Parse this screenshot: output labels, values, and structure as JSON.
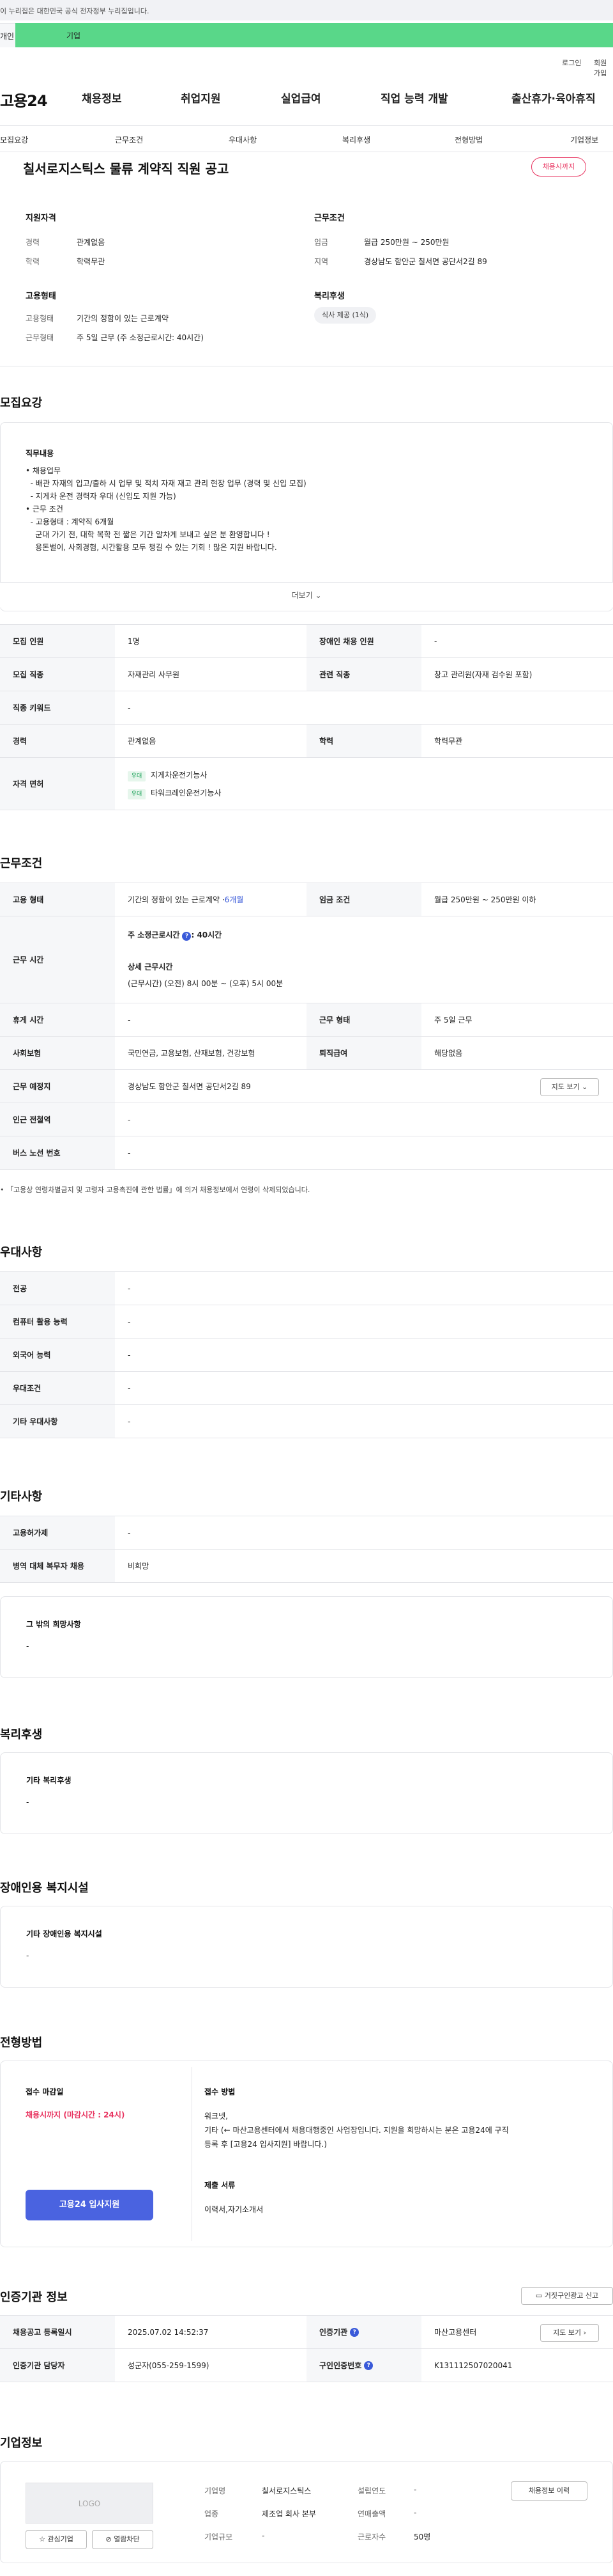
{
  "gov_banner": "이 누리집은 대한민국 공식 전자정부 누리집입니다.",
  "top_tabs": {
    "individual": "개인",
    "business": "기업"
  },
  "util": {
    "login": "로그인",
    "join": "회원가입"
  },
  "logo": "고용24",
  "nav": [
    "채용정보",
    "취업지원",
    "실업급여",
    "직업 능력 개발",
    "출산휴가·육아휴직"
  ],
  "subnav": [
    "모집요강",
    "근무조건",
    "우대사항",
    "복리후생",
    "전형방법",
    "기업정보"
  ],
  "job": {
    "title": "칠서로지스틱스 물류 계약직 직원 공고",
    "status": "채용시까지"
  },
  "summary": {
    "qual_title": "지원자격",
    "career_label": "경력",
    "career": "관계없음",
    "edu_label": "학력",
    "edu": "학력무관",
    "cond_title": "근무조건",
    "wage_label": "임금",
    "wage": "월급 250만원 ~ 250만원",
    "region_label": "지역",
    "region": "경상남도 함안군 칠서면 공단서2길 89",
    "form_title": "고용형태",
    "emp_label": "고용형태",
    "emp": "기간의 정함이 있는 근로계약",
    "work_label": "근무형태",
    "work": "주 5일 근무 (주 소정근로시간: 40시간)",
    "welfare_title": "복리후생",
    "welfare_chip": "식사 제공 (1식)"
  },
  "recruit": {
    "title": "모집요강",
    "duty_title": "직무내용",
    "duty_lines": [
      "• 채용업무",
      "  - 배관 자재의 입고/출하 시 업무 및 적치 자재 재고 관리 현장 업무 (경력 및 신입 모집)",
      "  - 지게차 운전 경력자 우대 (신입도 지원 가능)",
      "",
      "• 근무 조건",
      "  - 고용형태 : 계약직 6개월",
      "",
      "    군대 가기 전, 대학 복학 전 짧은 기간 알차게 보내고 싶은 분 환영합니다 !",
      "    용돈벌이, 사회경험, 시간활용 모두 챙길 수 있는 기회 ! 많은 지원 바랍니다."
    ],
    "more": "더보기",
    "people_label": "모집 인원",
    "people": "1명",
    "disabled_label": "장애인 채용 인원",
    "disabled": "-",
    "job_label": "모집 직종",
    "job": "자재관리 사무원",
    "related_label": "관련 직종",
    "related": "창고 관리원(자재 검수원 포함)",
    "kw_label": "직종 키워드",
    "kw": "-",
    "career_label": "경력",
    "career": "관계없음",
    "edu_label": "학력",
    "edu": "학력무관",
    "license_label": "자격 면허",
    "license_tag": "우대",
    "licenses": [
      "지게차운전기능사",
      "타워크레인운전기능사"
    ]
  },
  "work_cond": {
    "title": "근무조건",
    "emp_label": "고용 형태",
    "emp": "기간의 정함이 있는 근로계약 · ",
    "emp_period": "6개월",
    "wage_label": "임금 조건",
    "wage": "월급 250만원 ~ 250만원 이하",
    "hours_label": "근무 시간",
    "hours_weekly": "주 소정근로시간",
    "hours_weekly_val": ": 40시간",
    "hours_detail_title": "상세 근무시간",
    "hours_detail": "(근무시간) (오전) 8시 00분 ~ (오후) 5시 00분",
    "rest_label": "휴게 시간",
    "rest": "-",
    "form_label": "근무 형태",
    "form": "주 5일 근무",
    "ins_label": "사회보험",
    "ins": "국민연금, 고용보험, 산재보험, 건강보험",
    "sev_label": "퇴직급여",
    "sev": "해당없음",
    "place_label": "근무 예정지",
    "place": "경상남도 함안군 칠서면 공단서2길 89",
    "map_btn": "지도 보기",
    "station_label": "인근 전철역",
    "station": "-",
    "bus_label": "버스 노선 번호",
    "bus": "-",
    "note": "「고용상 연령차별금지 및 고령자 고용촉진에 관한 법률」에 의거 채용정보에서 연령이 삭제되었습니다."
  },
  "pref": {
    "title": "우대사항",
    "rows": [
      {
        "label": "전공",
        "value": "-"
      },
      {
        "label": "컴퓨터 활용 능력",
        "value": "-"
      },
      {
        "label": "외국어 능력",
        "value": "-"
      },
      {
        "label": "우대조건",
        "value": "-"
      },
      {
        "label": "기타 우대사항",
        "value": "-"
      }
    ]
  },
  "etc": {
    "title": "기타사항",
    "rows": [
      {
        "label": "고용허가제",
        "value": "-"
      },
      {
        "label": "병역 대체 복무자 채용",
        "value": "비희망"
      }
    ],
    "other_title": "그 밖의 희망사항",
    "other": "-"
  },
  "welfare": {
    "title": "복리후생",
    "sub": "기타 복리후생",
    "val": "-"
  },
  "disability": {
    "title": "장애인용 복지시설",
    "sub": "기타 장애인용 복지시설",
    "val": "-"
  },
  "process": {
    "title": "전형방법",
    "deadline_title": "접수 마감일",
    "deadline": "채용시까지 (마감시간 : 24시)",
    "apply_btn": "고용24 입사지원",
    "method_title": "접수 방법",
    "method_lines": [
      "워크넷,",
      "기타 (← 마산고용센터에서 채용대행중인 사업장입니다. 지원을 희망하시는 분은 고용24에 구직",
      "등록 후 [고용24 입사지원] 바랍니다.)"
    ],
    "docs_title": "제출 서류",
    "docs": "이력서,자기소개서"
  },
  "agency": {
    "title": "인증기관 정보",
    "report_btn": "거짓구인광고 신고",
    "reg_label": "채용공고 등록일시",
    "reg": "2025.07.02 14:52:37",
    "agency_label": "인증기관",
    "agency": "마산고용센터",
    "map_btn": "지도 보기",
    "mgr_label": "인증기관 담당자",
    "mgr": "성군자(055-259-1599)",
    "auth_label": "구인인증번호",
    "auth": "K131112507020041"
  },
  "company": {
    "title": "기업정보",
    "logo": "LOGO",
    "fav_btn": "관심기업",
    "block_btn": "열람차단",
    "name_label": "기업명",
    "name": "칠서로지스틱스",
    "year_label": "설립연도",
    "year": "-",
    "ind_label": "업종",
    "ind": "제조업 회사 본부",
    "sales_label": "연매출액",
    "sales": "-",
    "size_label": "기업규모",
    "size": "-",
    "emp_label": "근로자수",
    "emp": "50명",
    "hist_btn": "채용정보 이력"
  }
}
